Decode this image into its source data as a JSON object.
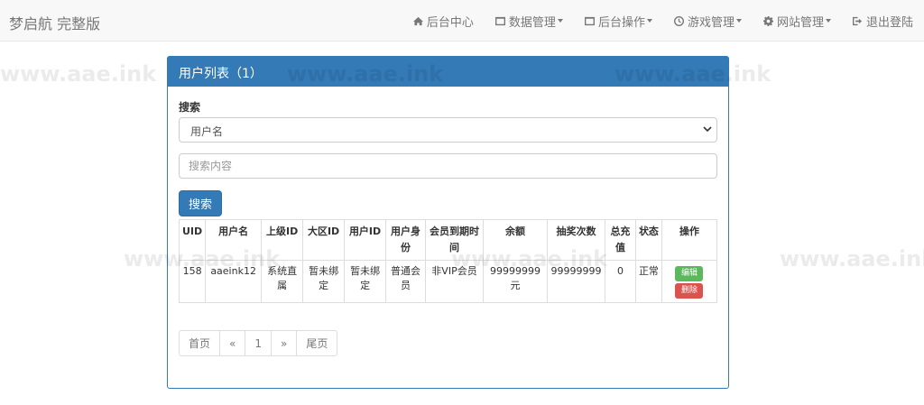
{
  "brand": "梦启航 完整版",
  "nav": {
    "items": [
      {
        "icon": "home-icon",
        "label": "后台中心"
      },
      {
        "icon": "data-manage-icon",
        "label": "数据管理"
      },
      {
        "icon": "backend-ops-icon",
        "label": "后台操作"
      },
      {
        "icon": "clock-icon",
        "label": "游戏管理"
      },
      {
        "icon": "gear-icon",
        "label": "网站管理"
      },
      {
        "icon": "logout-icon",
        "label": "退出登陆"
      }
    ]
  },
  "watermark": "www.aae.ink",
  "panel": {
    "title": "用户列表（1）",
    "search_label": "搜索",
    "select_value": "用户名",
    "input_placeholder": "搜索内容",
    "search_button": "搜索"
  },
  "table": {
    "headers": [
      "UID",
      "用户名",
      "上级ID",
      "大区ID",
      "用户ID",
      "用户身份",
      "会员到期时间",
      "余额",
      "抽奖次数",
      "总充值",
      "状态",
      "操作"
    ],
    "rows": [
      {
        "uid": "158",
        "username": "aaeink12",
        "parent_id": "系统直属",
        "region_id": "暂未绑定",
        "user_id": "暂未绑定",
        "identity": "普通会员",
        "vip_expire": "非VIP会员",
        "balance": "99999999元",
        "lottery": "99999999",
        "total_recharge": "0",
        "status": "正常",
        "edit": "编辑",
        "delete": "删除"
      }
    ]
  },
  "pagination": [
    "首页",
    "«",
    "1",
    "»",
    "尾页"
  ],
  "colors": {
    "primary": "#337ab7",
    "success": "#5cb85c",
    "danger": "#d9534f"
  }
}
